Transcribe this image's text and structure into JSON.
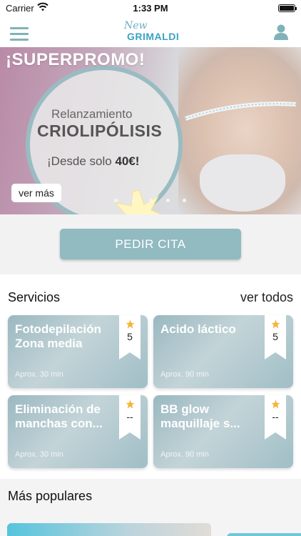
{
  "status_bar": {
    "carrier": "Carrier",
    "time": "1:33 PM"
  },
  "nav": {
    "logo_script": "New",
    "logo_brand": "GRIMALDI",
    "menu_icon": "hamburger-icon",
    "profile_icon": "person-icon"
  },
  "banner": {
    "title": "¡SUPERPROMO!",
    "subtitle": "Relanzamiento",
    "headline": "CRIOLIPÓLISIS",
    "price_prefix": "¡Desde solo ",
    "price": "40€!",
    "button": "ver más",
    "slide_count": 5
  },
  "cta": {
    "label": "PEDIR CITA"
  },
  "services": {
    "title": "Servicios",
    "see_all": "ver todos",
    "items": [
      {
        "name": "Fotodepilación Zona media",
        "duration": "Aprox. 30 min",
        "rating": "5"
      },
      {
        "name": "Acido láctico",
        "duration": "Aprox. 90 min",
        "rating": "5"
      },
      {
        "name": "Eliminación de manchas con...",
        "duration": "Aprox. 30 min",
        "rating": "--"
      },
      {
        "name": "BB glow maquillaje s...",
        "duration": "Aprox. 90 min",
        "rating": "--"
      }
    ]
  },
  "popular": {
    "title": "Más populares"
  },
  "colors": {
    "accent": "#91bac1",
    "star": "#f3b63a",
    "brand_blue": "#3ba2c4"
  }
}
